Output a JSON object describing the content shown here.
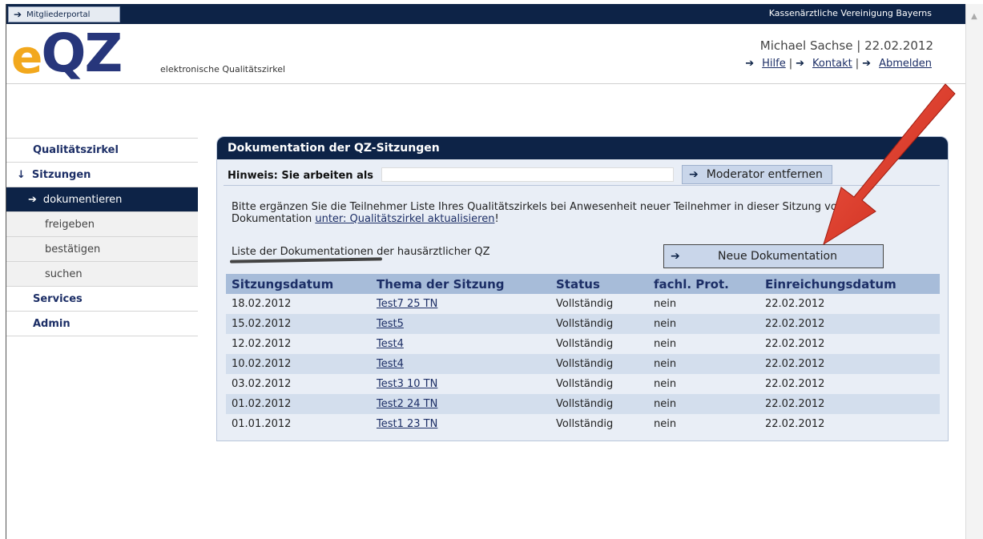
{
  "topbar": {
    "portal_tab": "Mitgliederportal",
    "org": "Kassenärztliche Vereinigung Bayerns"
  },
  "header": {
    "logo_e": "e",
    "logo_qz": "QZ",
    "tagline": "elektronische Qualitätszirkel",
    "user": "Michael Sachse",
    "date": "22.02.2012",
    "sep": "|",
    "links": [
      "Hilfe",
      "Kontakt",
      "Abmelden"
    ]
  },
  "nav": {
    "qualitaetszirkel": "Qualitätszirkel",
    "sitzungen": "Sitzungen",
    "dokumentieren": "dokumentieren",
    "freigeben": "freigeben",
    "bestaetigen": "bestätigen",
    "suchen": "suchen",
    "services": "Services",
    "admin": "Admin"
  },
  "panel": {
    "title": "Dokumentation der QZ-Sitzungen",
    "hinweis": "Hinweis: Sie arbeiten als",
    "moderator_button": "Moderator entfernen",
    "info_text": "Bitte ergänzen Sie die Teilnehmer Liste Ihres Qualitätszirkels bei Anwesenheit neuer Teilnehmer in dieser Sitzung vor der Dokumentation ",
    "info_link": "unter: Qualitätszirkel aktualisieren",
    "info_end": "!",
    "list_label": "Liste der Dokumentationen der hausärztlicher QZ",
    "new_button": "Neue Dokumentation"
  },
  "table": {
    "headers": [
      "Sitzungsdatum",
      "Thema der Sitzung",
      "Status",
      "fachl. Prot.",
      "Einreichungsdatum"
    ],
    "rows": [
      [
        "18.02.2012",
        "Test7 25 TN",
        "Vollständig",
        "nein",
        "22.02.2012"
      ],
      [
        "15.02.2012",
        "Test5",
        "Vollständig",
        "nein",
        "22.02.2012"
      ],
      [
        "12.02.2012",
        "Test4",
        "Vollständig",
        "nein",
        "22.02.2012"
      ],
      [
        "10.02.2012",
        "Test4",
        "Vollständig",
        "nein",
        "22.02.2012"
      ],
      [
        "03.02.2012",
        "Test3 10 TN",
        "Vollständig",
        "nein",
        "22.02.2012"
      ],
      [
        "01.02.2012",
        "Test2 24 TN",
        "Vollständig",
        "nein",
        "22.02.2012"
      ],
      [
        "01.01.2012",
        "Test1 23 TN",
        "Vollständig",
        "nein",
        "22.02.2012"
      ]
    ]
  },
  "colors": {
    "navy": "#0d2347",
    "accent_orange": "#f2a81d",
    "logo_blue": "#27367b",
    "annotation_red": "#e53a2b"
  },
  "icons": [
    "arrow-right-icon",
    "arrow-down-icon",
    "red-pointer-arrow"
  ]
}
